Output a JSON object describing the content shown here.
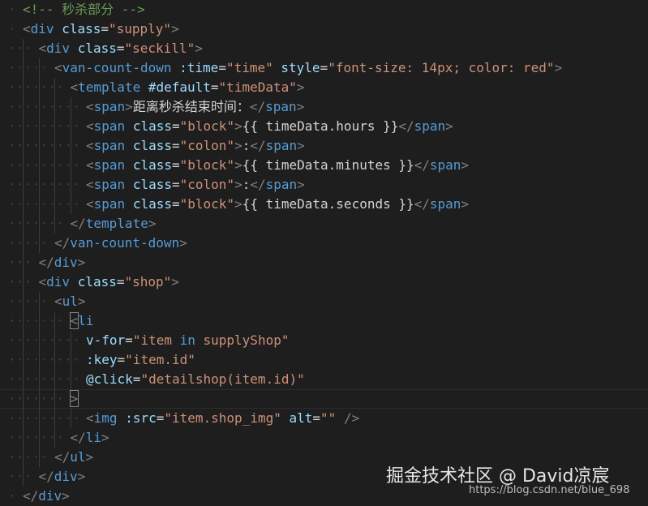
{
  "editor": {
    "lines": [
      {
        "indent": 0,
        "tokens": [
          {
            "c": "t-comment",
            "t": "<!-- 秒杀部分 -->"
          }
        ]
      },
      {
        "indent": 0,
        "tokens": [
          {
            "c": "t-bracket",
            "t": "<"
          },
          {
            "c": "t-tag",
            "t": "div"
          },
          {
            "c": "t-text",
            "t": " "
          },
          {
            "c": "t-attr",
            "t": "class"
          },
          {
            "c": "t-text",
            "t": "="
          },
          {
            "c": "t-str",
            "t": "\"supply\""
          },
          {
            "c": "t-bracket",
            "t": ">"
          }
        ]
      },
      {
        "indent": 1,
        "tokens": [
          {
            "c": "t-bracket",
            "t": "<"
          },
          {
            "c": "t-tag",
            "t": "div"
          },
          {
            "c": "t-text",
            "t": " "
          },
          {
            "c": "t-attr",
            "t": "class"
          },
          {
            "c": "t-text",
            "t": "="
          },
          {
            "c": "t-str",
            "t": "\"seckill\""
          },
          {
            "c": "t-bracket",
            "t": ">"
          }
        ]
      },
      {
        "indent": 2,
        "tokens": [
          {
            "c": "t-bracket",
            "t": "<"
          },
          {
            "c": "t-tag",
            "t": "van-count-down"
          },
          {
            "c": "t-text",
            "t": " "
          },
          {
            "c": "t-attr",
            "t": ":time"
          },
          {
            "c": "t-text",
            "t": "="
          },
          {
            "c": "t-str",
            "t": "\"time\""
          },
          {
            "c": "t-text",
            "t": " "
          },
          {
            "c": "t-attr",
            "t": "style"
          },
          {
            "c": "t-text",
            "t": "="
          },
          {
            "c": "t-str",
            "t": "\"font-size: 14px; color: red\""
          },
          {
            "c": "t-bracket",
            "t": ">"
          }
        ]
      },
      {
        "indent": 3,
        "tokens": [
          {
            "c": "t-bracket",
            "t": "<"
          },
          {
            "c": "t-tag",
            "t": "template"
          },
          {
            "c": "t-text",
            "t": " "
          },
          {
            "c": "t-attr",
            "t": "#default"
          },
          {
            "c": "t-text",
            "t": "="
          },
          {
            "c": "t-str",
            "t": "\"timeData\""
          },
          {
            "c": "t-bracket",
            "t": ">"
          }
        ]
      },
      {
        "indent": 4,
        "tokens": [
          {
            "c": "t-bracket",
            "t": "<"
          },
          {
            "c": "t-tag",
            "t": "span"
          },
          {
            "c": "t-bracket",
            "t": ">"
          },
          {
            "c": "t-text",
            "t": "距离秒杀结束时间："
          },
          {
            "c": "t-bracket",
            "t": "</"
          },
          {
            "c": "t-tag",
            "t": "span"
          },
          {
            "c": "t-bracket",
            "t": ">"
          }
        ]
      },
      {
        "indent": 4,
        "tokens": [
          {
            "c": "t-bracket",
            "t": "<"
          },
          {
            "c": "t-tag",
            "t": "span"
          },
          {
            "c": "t-text",
            "t": " "
          },
          {
            "c": "t-attr",
            "t": "class"
          },
          {
            "c": "t-text",
            "t": "="
          },
          {
            "c": "t-str",
            "t": "\"block\""
          },
          {
            "c": "t-bracket",
            "t": ">"
          },
          {
            "c": "t-text",
            "t": "{{ timeData.hours }}"
          },
          {
            "c": "t-bracket",
            "t": "</"
          },
          {
            "c": "t-tag",
            "t": "span"
          },
          {
            "c": "t-bracket",
            "t": ">"
          }
        ]
      },
      {
        "indent": 4,
        "tokens": [
          {
            "c": "t-bracket",
            "t": "<"
          },
          {
            "c": "t-tag",
            "t": "span"
          },
          {
            "c": "t-text",
            "t": " "
          },
          {
            "c": "t-attr",
            "t": "class"
          },
          {
            "c": "t-text",
            "t": "="
          },
          {
            "c": "t-str",
            "t": "\"colon\""
          },
          {
            "c": "t-bracket",
            "t": ">"
          },
          {
            "c": "t-text",
            "t": ":"
          },
          {
            "c": "t-bracket",
            "t": "</"
          },
          {
            "c": "t-tag",
            "t": "span"
          },
          {
            "c": "t-bracket",
            "t": ">"
          }
        ]
      },
      {
        "indent": 4,
        "tokens": [
          {
            "c": "t-bracket",
            "t": "<"
          },
          {
            "c": "t-tag",
            "t": "span"
          },
          {
            "c": "t-text",
            "t": " "
          },
          {
            "c": "t-attr",
            "t": "class"
          },
          {
            "c": "t-text",
            "t": "="
          },
          {
            "c": "t-str",
            "t": "\"block\""
          },
          {
            "c": "t-bracket",
            "t": ">"
          },
          {
            "c": "t-text",
            "t": "{{ timeData.minutes }}"
          },
          {
            "c": "t-bracket",
            "t": "</"
          },
          {
            "c": "t-tag",
            "t": "span"
          },
          {
            "c": "t-bracket",
            "t": ">"
          }
        ]
      },
      {
        "indent": 4,
        "tokens": [
          {
            "c": "t-bracket",
            "t": "<"
          },
          {
            "c": "t-tag",
            "t": "span"
          },
          {
            "c": "t-text",
            "t": " "
          },
          {
            "c": "t-attr",
            "t": "class"
          },
          {
            "c": "t-text",
            "t": "="
          },
          {
            "c": "t-str",
            "t": "\"colon\""
          },
          {
            "c": "t-bracket",
            "t": ">"
          },
          {
            "c": "t-text",
            "t": ":"
          },
          {
            "c": "t-bracket",
            "t": "</"
          },
          {
            "c": "t-tag",
            "t": "span"
          },
          {
            "c": "t-bracket",
            "t": ">"
          }
        ]
      },
      {
        "indent": 4,
        "tokens": [
          {
            "c": "t-bracket",
            "t": "<"
          },
          {
            "c": "t-tag",
            "t": "span"
          },
          {
            "c": "t-text",
            "t": " "
          },
          {
            "c": "t-attr",
            "t": "class"
          },
          {
            "c": "t-text",
            "t": "="
          },
          {
            "c": "t-str",
            "t": "\"block\""
          },
          {
            "c": "t-bracket",
            "t": ">"
          },
          {
            "c": "t-text",
            "t": "{{ timeData.seconds }}"
          },
          {
            "c": "t-bracket",
            "t": "</"
          },
          {
            "c": "t-tag",
            "t": "span"
          },
          {
            "c": "t-bracket",
            "t": ">"
          }
        ]
      },
      {
        "indent": 3,
        "tokens": [
          {
            "c": "t-bracket",
            "t": "</"
          },
          {
            "c": "t-tag",
            "t": "template"
          },
          {
            "c": "t-bracket",
            "t": ">"
          }
        ]
      },
      {
        "indent": 2,
        "tokens": [
          {
            "c": "t-bracket",
            "t": "</"
          },
          {
            "c": "t-tag",
            "t": "van-count-down"
          },
          {
            "c": "t-bracket",
            "t": ">"
          }
        ]
      },
      {
        "indent": 1,
        "tokens": [
          {
            "c": "t-bracket",
            "t": "</"
          },
          {
            "c": "t-tag",
            "t": "div"
          },
          {
            "c": "t-bracket",
            "t": ">"
          }
        ]
      },
      {
        "indent": 1,
        "tokens": [
          {
            "c": "t-bracket",
            "t": "<"
          },
          {
            "c": "t-tag",
            "t": "div"
          },
          {
            "c": "t-text",
            "t": " "
          },
          {
            "c": "t-attr",
            "t": "class"
          },
          {
            "c": "t-text",
            "t": "="
          },
          {
            "c": "t-str",
            "t": "\"shop\""
          },
          {
            "c": "t-bracket",
            "t": ">"
          }
        ]
      },
      {
        "indent": 2,
        "tokens": [
          {
            "c": "t-bracket",
            "t": "<"
          },
          {
            "c": "t-tag",
            "t": "ul"
          },
          {
            "c": "t-bracket",
            "t": ">"
          }
        ]
      },
      {
        "indent": 3,
        "tokens": [
          {
            "c": "t-bracket match",
            "t": "<"
          },
          {
            "c": "t-tag",
            "t": "li"
          }
        ]
      },
      {
        "indent": 4,
        "tokens": [
          {
            "c": "t-attr",
            "t": "v-for"
          },
          {
            "c": "t-text",
            "t": "="
          },
          {
            "c": "t-str",
            "t": "\"item "
          },
          {
            "c": "t-kw",
            "t": "in"
          },
          {
            "c": "t-str",
            "t": " supplyShop\""
          }
        ]
      },
      {
        "indent": 4,
        "tokens": [
          {
            "c": "t-attr",
            "t": ":key"
          },
          {
            "c": "t-text",
            "t": "="
          },
          {
            "c": "t-str",
            "t": "\"item.id\""
          }
        ]
      },
      {
        "indent": 4,
        "tokens": [
          {
            "c": "t-attr",
            "t": "@click"
          },
          {
            "c": "t-text",
            "t": "="
          },
          {
            "c": "t-str",
            "t": "\"detailshop(item.id)\""
          }
        ]
      },
      {
        "indent": 3,
        "cursor": true,
        "tokens": [
          {
            "c": "t-bracket match",
            "t": ">"
          }
        ]
      },
      {
        "indent": 4,
        "tokens": [
          {
            "c": "t-bracket",
            "t": "<"
          },
          {
            "c": "t-tag",
            "t": "img"
          },
          {
            "c": "t-text",
            "t": " "
          },
          {
            "c": "t-attr",
            "t": ":src"
          },
          {
            "c": "t-text",
            "t": "="
          },
          {
            "c": "t-str",
            "t": "\"item.shop_img\""
          },
          {
            "c": "t-text",
            "t": " "
          },
          {
            "c": "t-attr",
            "t": "alt"
          },
          {
            "c": "t-text",
            "t": "="
          },
          {
            "c": "t-str",
            "t": "\"\""
          },
          {
            "c": "t-text",
            "t": " "
          },
          {
            "c": "t-bracket",
            "t": "/>"
          }
        ]
      },
      {
        "indent": 3,
        "tokens": [
          {
            "c": "t-bracket",
            "t": "</"
          },
          {
            "c": "t-tag",
            "t": "li"
          },
          {
            "c": "t-bracket",
            "t": ">"
          }
        ]
      },
      {
        "indent": 2,
        "tokens": [
          {
            "c": "t-bracket",
            "t": "</"
          },
          {
            "c": "t-tag",
            "t": "ul"
          },
          {
            "c": "t-bracket",
            "t": ">"
          }
        ]
      },
      {
        "indent": 1,
        "tokens": [
          {
            "c": "t-bracket",
            "t": "</"
          },
          {
            "c": "t-tag",
            "t": "div"
          },
          {
            "c": "t-bracket",
            "t": ">"
          }
        ]
      },
      {
        "indent": 0,
        "tokens": [
          {
            "c": "t-bracket",
            "t": "</"
          },
          {
            "c": "t-tag",
            "t": "div"
          },
          {
            "c": "t-bracket",
            "t": ">"
          }
        ]
      }
    ]
  },
  "watermark": {
    "brand": "掘金技术社区 @ David凉宸",
    "url": "https://blog.csdn.net/blue_698"
  },
  "colors": {
    "background": "#1e1e1e",
    "tag": "#569cd6",
    "attribute": "#9cdcfe",
    "string": "#ce9178",
    "comment": "#6a9955",
    "text": "#d4d4d4"
  }
}
